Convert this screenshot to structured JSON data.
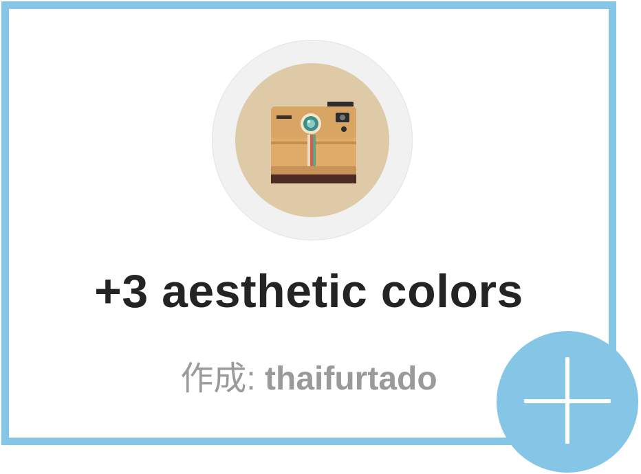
{
  "card": {
    "avatar_icon": "instant-camera-icon",
    "title": "+3 aesthetic colors",
    "byline_prefix": "作成:",
    "author": "thaifurtado"
  },
  "actions": {
    "add_icon": "plus-icon"
  },
  "colors": {
    "accent": "#85c6e6",
    "title_text": "#242424",
    "byline_text": "#9a9a9a",
    "avatar_background": "#dfcaa8"
  }
}
